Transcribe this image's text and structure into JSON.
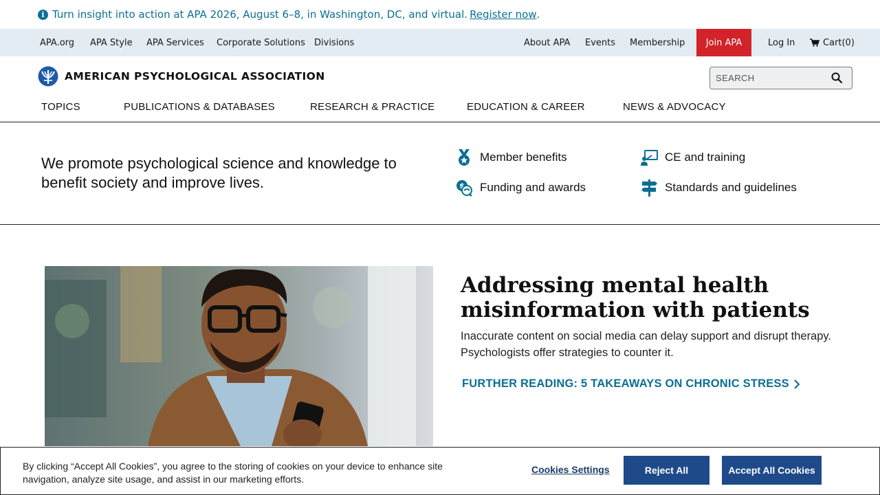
{
  "announcement": {
    "text": "Turn insight into action at APA 2026, August 6–8, in Washington, DC, and virtual.",
    "link": "Register now",
    "trail": "."
  },
  "utility_nav": {
    "left": [
      "APA.org",
      "APA Style",
      "APA Services",
      "Corporate Solutions",
      "Divisions"
    ],
    "about": "About APA",
    "events": "Events",
    "membership": "Membership",
    "join": "Join APA",
    "login": "Log In",
    "cart": "Cart(0)"
  },
  "header": {
    "logo_text": "AMERICAN PSYCHOLOGICAL ASSOCIATION",
    "search_placeholder": "SEARCH"
  },
  "main_nav": [
    "TOPICS",
    "PUBLICATIONS & DATABASES",
    "RESEARCH & PRACTICE",
    "EDUCATION & CAREER",
    "NEWS & ADVOCACY"
  ],
  "mission": {
    "tagline": "We promote psychological science and knowledge to benefit society and improve lives.",
    "links": {
      "member_benefits": "Member benefits",
      "ce_training": "CE and training",
      "funding_awards": "Funding and awards",
      "standards": "Standards and guidelines"
    }
  },
  "feature": {
    "title": "Addressing mental health misinformation with patients",
    "description": "Inaccurate content on social media can delay support and disrupt therapy. Psychologists offer strategies to counter it.",
    "further_reading": "FURTHER READING: 5 TAKEAWAYS ON CHRONIC STRESS"
  },
  "cookie_banner": {
    "text": "By clicking “Accept All Cookies”, you agree to the storing of cookies on your device to enhance site navigation, analyze site usage, and assist in our marketing efforts.",
    "settings": "Cookies Settings",
    "reject": "Reject All",
    "accept": "Accept All Cookies"
  },
  "colors": {
    "accent_teal": "#0b6f93",
    "join_red": "#d2232a",
    "utility_bg": "#e3ecf3",
    "button_navy": "#1f4a8a"
  }
}
